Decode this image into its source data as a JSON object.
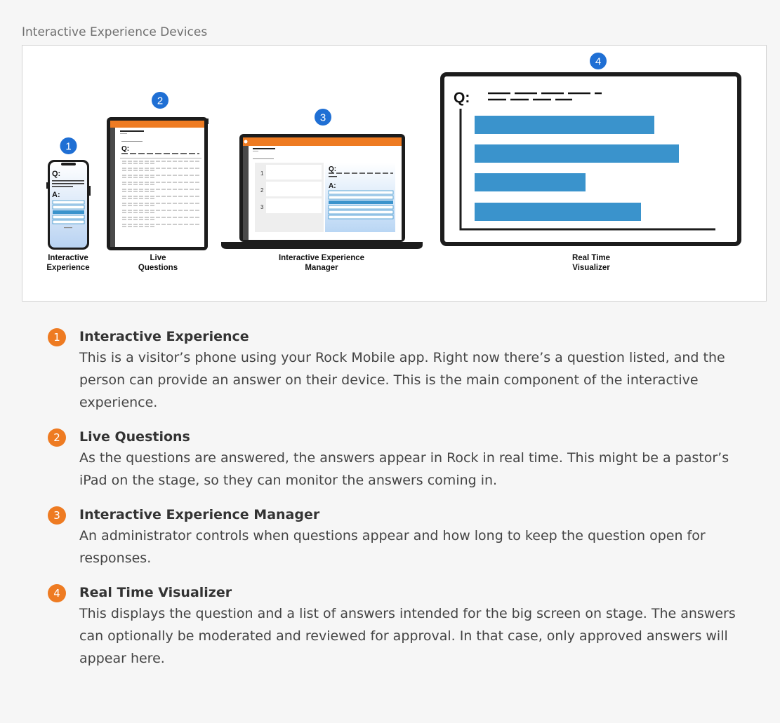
{
  "caption": "Interactive Experience Devices",
  "colors": {
    "accent": "#ee7b22",
    "marker_blue": "#1f6fd4",
    "bar_blue": "#3a93cc"
  },
  "figure": {
    "markers": [
      "1",
      "2",
      "3",
      "4"
    ],
    "devices": [
      {
        "label_lines": [
          "Interactive",
          "Experience"
        ]
      },
      {
        "label_lines": [
          "Live",
          "Questions"
        ]
      },
      {
        "label_lines": [
          "Interactive Experience",
          "Manager"
        ]
      },
      {
        "label_lines": [
          "Real Time",
          "Visualizer"
        ]
      }
    ],
    "q_label": "Q:",
    "a_label": "A:",
    "manager_rows": [
      "1",
      "2",
      "3"
    ]
  },
  "items": [
    {
      "number": "1",
      "title": "Interactive Experience",
      "text": "This is a visitor’s phone using your Rock Mobile app. Right now there’s a question listed, and the person can provide an answer on their device. This is the main component of the interactive experience."
    },
    {
      "number": "2",
      "title": "Live Questions",
      "text": "As the questions are answered, the answers appear in Rock in real time. This might be a pastor’s iPad on the stage, so they can monitor the answers coming in."
    },
    {
      "number": "3",
      "title": "Interactive Experience Manager",
      "text": "An administrator controls when questions appear and how long to keep the question open for responses."
    },
    {
      "number": "4",
      "title": "Real Time Visualizer",
      "text": "This displays the question and a list of answers intended for the big screen on stage. The answers can optionally be moderated and reviewed for approval. In that case, only approved answers will appear here."
    }
  ]
}
